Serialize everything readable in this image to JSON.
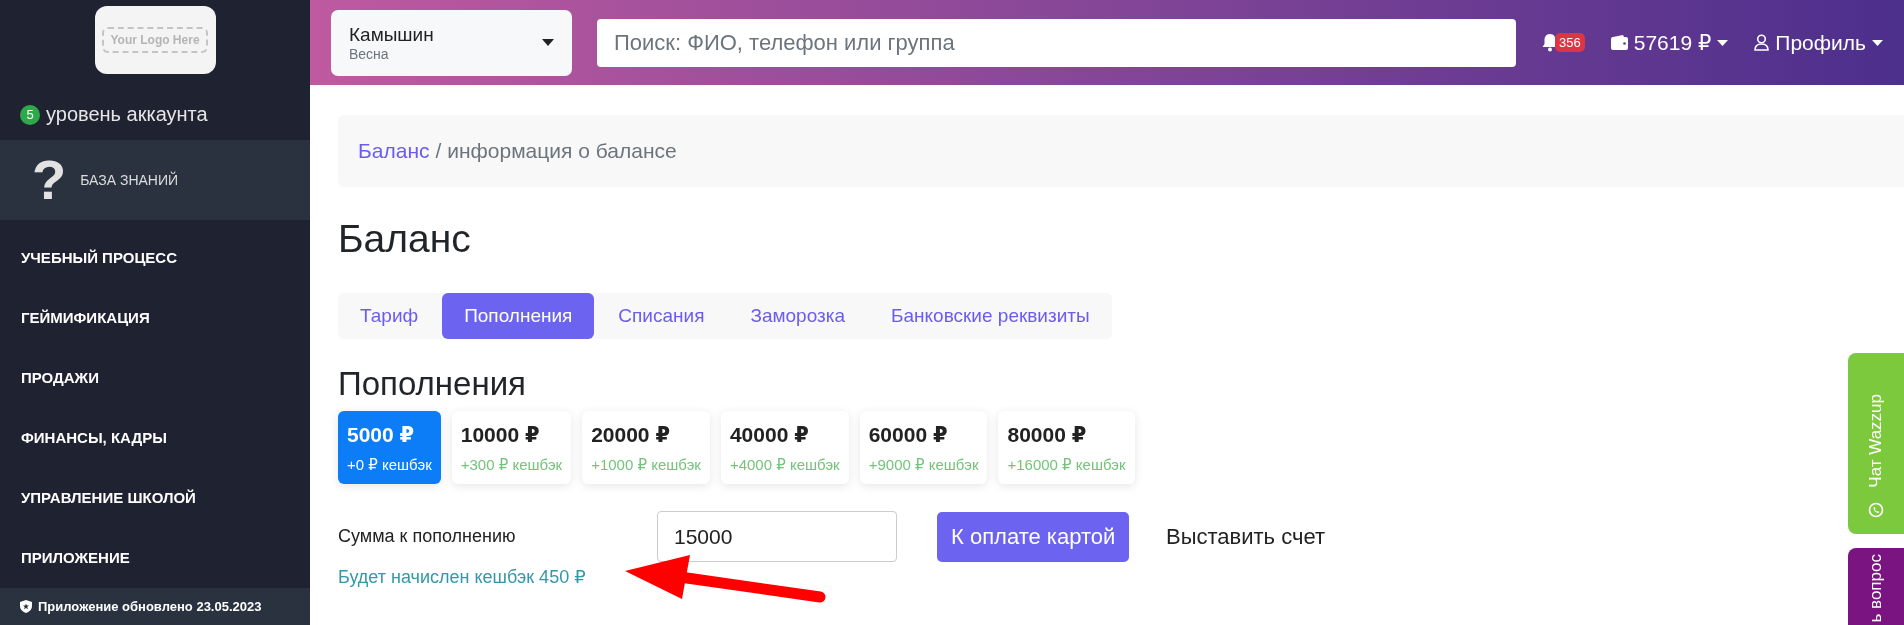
{
  "sidebar": {
    "logo": "Your Logo Here",
    "level": {
      "badge": "5",
      "label": "уровень аккаунта"
    },
    "knowledge_base": {
      "icon": "?",
      "label": "БАЗА ЗНАНИЙ"
    },
    "items": [
      {
        "label": "УЧЕБНЫЙ ПРОЦЕСС"
      },
      {
        "label": "ГЕЙМИФИКАЦИЯ"
      },
      {
        "label": "ПРОДАЖИ"
      },
      {
        "label": "ФИНАНСЫ, КАДРЫ"
      },
      {
        "label": "УПРАВЛЕНИЕ ШКОЛОЙ"
      },
      {
        "label": "ПРИЛОЖЕНИЕ"
      }
    ],
    "footer": "Приложение обновлено 23.05.2023"
  },
  "header": {
    "branch": {
      "name": "Камышин",
      "season": "Весна"
    },
    "search": {
      "placeholder": "Поиск: ФИО, телефон или группа"
    },
    "notifications": "356",
    "balance": "57619 ₽",
    "profile": "Профиль"
  },
  "breadcrumb": {
    "link": "Баланс",
    "current": "/ информация о балансе"
  },
  "title": "Баланс",
  "tabs": [
    {
      "label": "Тариф",
      "selected": false
    },
    {
      "label": "Пополнения",
      "selected": true
    },
    {
      "label": "Списания",
      "selected": false
    },
    {
      "label": "Заморозка",
      "selected": false
    },
    {
      "label": "Банковские реквизиты",
      "selected": false
    }
  ],
  "section_title": "Пополнения",
  "amounts": [
    {
      "amount": "5000 ₽",
      "cashback": "+0 ₽ кешбэк",
      "selected": true
    },
    {
      "amount": "10000 ₽",
      "cashback": "+300 ₽ кешбэк",
      "selected": false
    },
    {
      "amount": "20000 ₽",
      "cashback": "+1000 ₽ кешбэк",
      "selected": false
    },
    {
      "amount": "40000 ₽",
      "cashback": "+4000 ₽ кешбэк",
      "selected": false
    },
    {
      "amount": "60000 ₽",
      "cashback": "+9000 ₽ кешбэк",
      "selected": false
    },
    {
      "amount": "80000 ₽",
      "cashback": "+16000 ₽ кешбэк",
      "selected": false
    }
  ],
  "form": {
    "label": "Сумма к пополнению",
    "value": "15000",
    "pay_button": "К оплате картой",
    "invoice_button": "Выставить счет",
    "cashback_note": "Будет начислен кешбэк 450 ₽"
  },
  "side_tabs": [
    {
      "label": "Чат Wazzup",
      "color": "#7dc93e"
    },
    {
      "label": "ь вопрос",
      "color": "#7a1480"
    }
  ]
}
